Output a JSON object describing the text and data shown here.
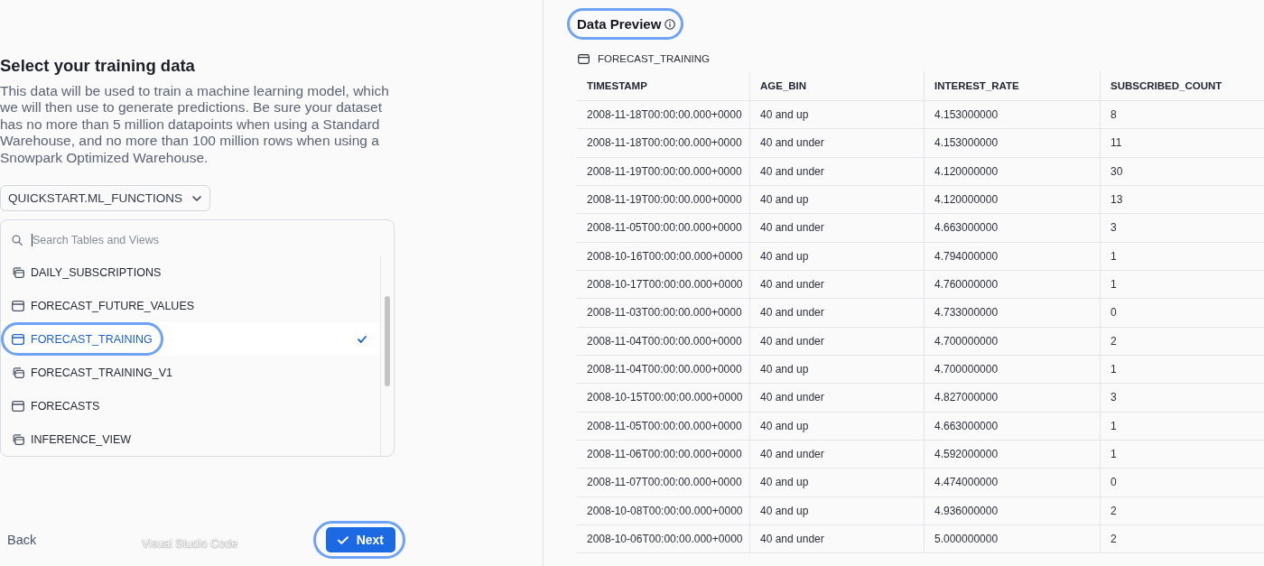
{
  "wizard": {
    "title": "Select your training data",
    "description": "This data will be used to train a machine learning model, which we will then use to generate predictions. Be sure your dataset has no more than 5 million datapoints when using a Standard Warehouse, and no more than 100 million rows when using a Snowpark Optimized Warehouse.",
    "schema_select": {
      "value": "QUICKSTART.ML_FUNCTIONS"
    },
    "search": {
      "placeholder": "Search Tables and Views",
      "focused": true
    },
    "items": [
      {
        "label": "DAILY_SUBSCRIPTIONS",
        "kind": "view",
        "selected": false,
        "highlighted": false
      },
      {
        "label": "FORECAST_FUTURE_VALUES",
        "kind": "table",
        "selected": false,
        "highlighted": false
      },
      {
        "label": "FORECAST_TRAINING",
        "kind": "table",
        "selected": true,
        "highlighted": true
      },
      {
        "label": "FORECAST_TRAINING_V1",
        "kind": "view",
        "selected": false,
        "highlighted": false
      },
      {
        "label": "FORECASTS",
        "kind": "table",
        "selected": false,
        "highlighted": false
      },
      {
        "label": "INFERENCE_VIEW",
        "kind": "view",
        "selected": false,
        "highlighted": false
      }
    ],
    "back_button": {
      "label": "Back"
    },
    "next_button": {
      "label": "Next",
      "highlighted": true
    }
  },
  "overlay": {
    "app_label": "Visual Studio Code"
  },
  "preview": {
    "title": "Data Preview",
    "highlighted": true,
    "source": {
      "label": "FORECAST_TRAINING"
    },
    "table": {
      "columns": [
        "TIMESTAMP",
        "AGE_BIN",
        "INTEREST_RATE",
        "SUBSCRIBED_COUNT"
      ],
      "rows": [
        [
          "2008-11-18T00:00:00.000+0000",
          "40 and up",
          "4.153000000",
          "8"
        ],
        [
          "2008-11-18T00:00:00.000+0000",
          "40 and under",
          "4.153000000",
          "11"
        ],
        [
          "2008-11-19T00:00:00.000+0000",
          "40 and under",
          "4.120000000",
          "30"
        ],
        [
          "2008-11-19T00:00:00.000+0000",
          "40 and up",
          "4.120000000",
          "13"
        ],
        [
          "2008-11-05T00:00:00.000+0000",
          "40 and under",
          "4.663000000",
          "3"
        ],
        [
          "2008-10-16T00:00:00.000+0000",
          "40 and up",
          "4.794000000",
          "1"
        ],
        [
          "2008-10-17T00:00:00.000+0000",
          "40 and under",
          "4.760000000",
          "1"
        ],
        [
          "2008-11-03T00:00:00.000+0000",
          "40 and under",
          "4.733000000",
          "0"
        ],
        [
          "2008-11-04T00:00:00.000+0000",
          "40 and under",
          "4.700000000",
          "2"
        ],
        [
          "2008-11-04T00:00:00.000+0000",
          "40 and up",
          "4.700000000",
          "1"
        ],
        [
          "2008-10-15T00:00:00.000+0000",
          "40 and under",
          "4.827000000",
          "3"
        ],
        [
          "2008-11-05T00:00:00.000+0000",
          "40 and up",
          "4.663000000",
          "1"
        ],
        [
          "2008-11-06T00:00:00.000+0000",
          "40 and under",
          "4.592000000",
          "1"
        ],
        [
          "2008-11-07T00:00:00.000+0000",
          "40 and up",
          "4.474000000",
          "0"
        ],
        [
          "2008-10-08T00:00:00.000+0000",
          "40 and up",
          "4.936000000",
          "2"
        ],
        [
          "2008-10-06T00:00:00.000+0000",
          "40 and under",
          "5.000000000",
          "2"
        ]
      ]
    }
  }
}
